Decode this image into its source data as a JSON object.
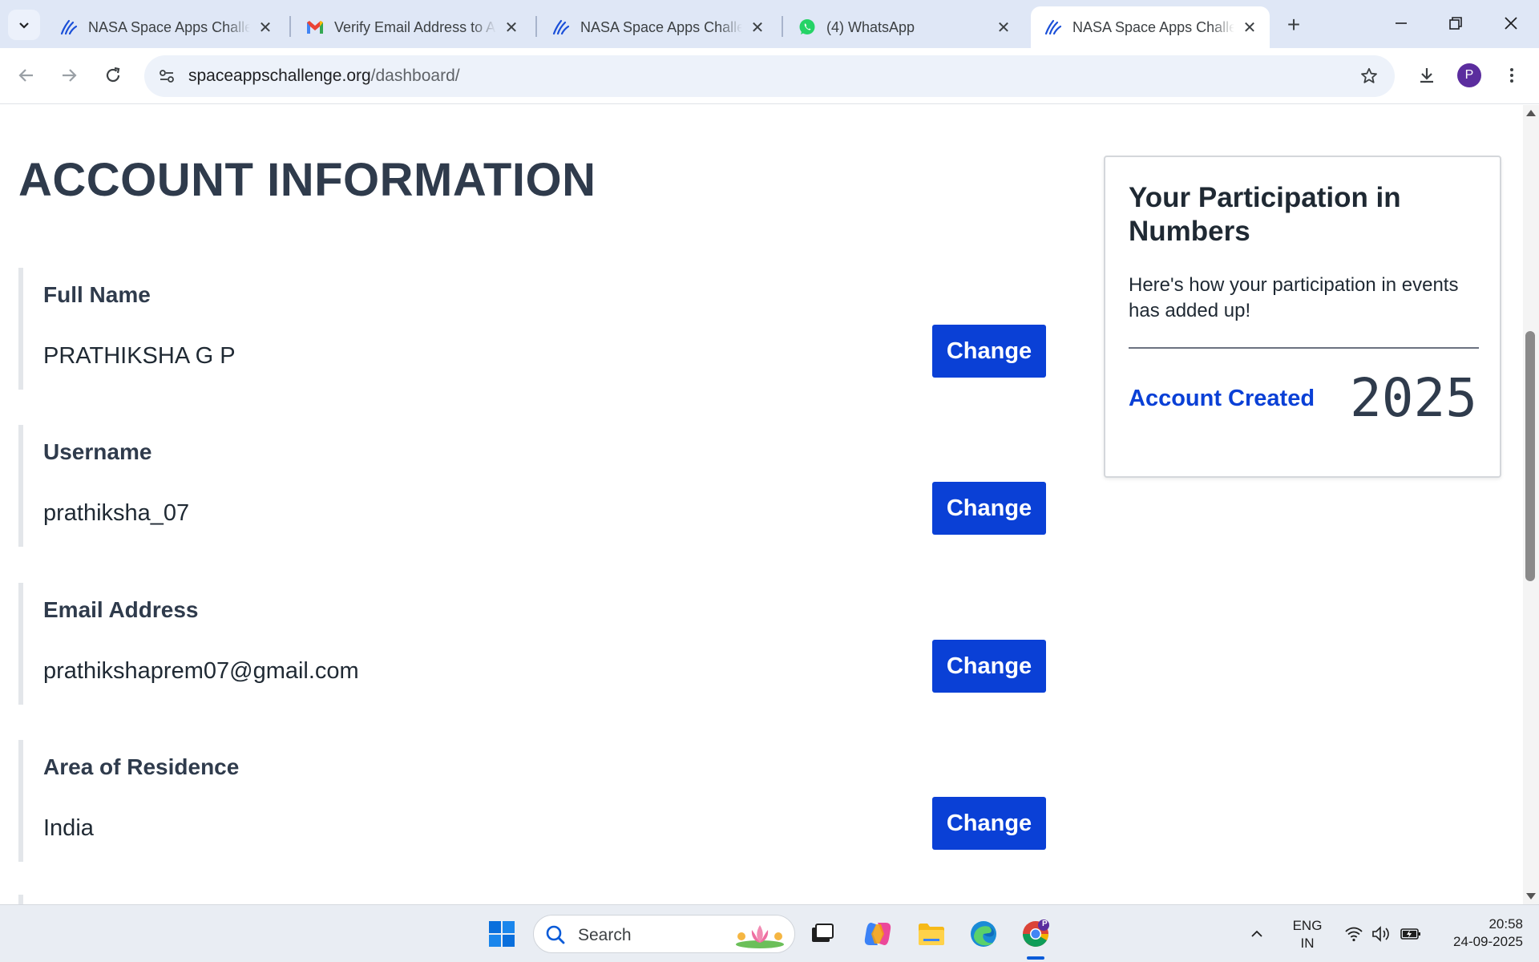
{
  "browser": {
    "tabs": [
      {
        "title": "NASA Space Apps Challenge",
        "favicon": "spaceapps-icon",
        "active": false
      },
      {
        "title": "Verify Email Address to Access",
        "favicon": "gmail-icon",
        "active": false
      },
      {
        "title": "NASA Space Apps Challenge",
        "favicon": "spaceapps-icon",
        "active": false
      },
      {
        "title": "(4) WhatsApp",
        "favicon": "whatsapp-icon",
        "active": false
      },
      {
        "title": "NASA Space Apps Challenge",
        "favicon": "spaceapps-icon",
        "active": true
      }
    ],
    "url_host": "spaceappschallenge.org",
    "url_path": "/dashboard/",
    "profile_initial": "P"
  },
  "page": {
    "title": "ACCOUNT INFORMATION",
    "fields": [
      {
        "label": "Full Name",
        "value": "PRATHIKSHA G P",
        "button": "Change"
      },
      {
        "label": "Username",
        "value": "prathiksha_07",
        "button": "Change"
      },
      {
        "label": "Email Address",
        "value": "prathikshaprem07@gmail.com",
        "button": "Change"
      },
      {
        "label": "Area of Residence",
        "value": "India",
        "button": "Change"
      }
    ],
    "participation_card": {
      "title": "Your Participation in Numbers",
      "description": "Here's how your participation in events has added up!",
      "stat_label": "Account Created",
      "stat_value": "2025"
    }
  },
  "taskbar": {
    "search_placeholder": "Search",
    "language_line1": "ENG",
    "language_line2": "IN",
    "time": "20:58",
    "date": "24-09-2025",
    "chrome_badge": "P"
  },
  "colors": {
    "accent_blue": "#0a40d6",
    "heading": "#2f3b4c",
    "tabbar_bg": "#dfe7f6"
  }
}
